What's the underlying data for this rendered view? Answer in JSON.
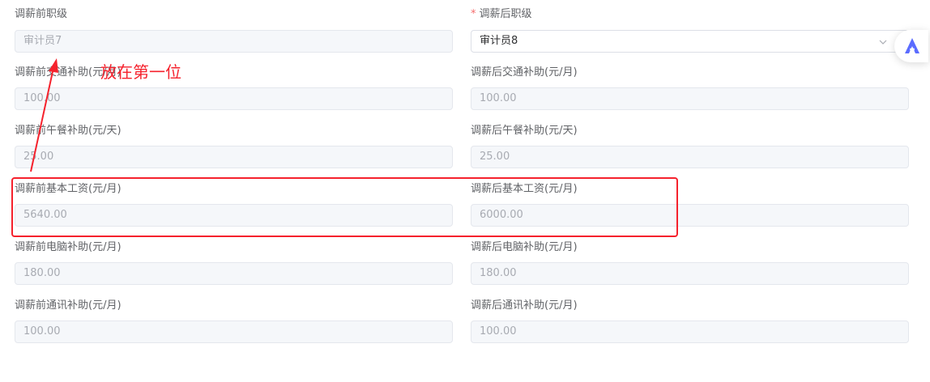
{
  "form": {
    "fields": [
      {
        "before_label": "调薪前职级",
        "before_value": "审计员7",
        "after_label": "调薪后职级",
        "after_value": "审计员8",
        "after_required": "*"
      },
      {
        "before_label": "调薪前交通补助(元/月)",
        "before_value": "100.00",
        "after_label": "调薪后交通补助(元/月)",
        "after_value": "100.00"
      },
      {
        "before_label": "调薪前午餐补助(元/天)",
        "before_value": "25.00",
        "after_label": "调薪后午餐补助(元/天)",
        "after_value": "25.00"
      },
      {
        "before_label": "调薪前基本工资(元/月)",
        "before_value": "5640.00",
        "after_label": "调薪后基本工资(元/月)",
        "after_value": "6000.00"
      },
      {
        "before_label": "调薪前电脑补助(元/月)",
        "before_value": "180.00",
        "after_label": "调薪后电脑补助(元/月)",
        "after_value": "180.00"
      },
      {
        "before_label": "调薪前通讯补助(元/月)",
        "before_value": "100.00",
        "after_label": "调薪后通讯补助(元/月)",
        "after_value": "100.00"
      }
    ]
  },
  "annotation": {
    "text": "放在第一位",
    "color": "#f5222d"
  },
  "icons": {
    "select_arrow": "chevron-down-icon",
    "clear": "circle-clear-icon",
    "assistant": "assistant-logo-icon"
  },
  "colors": {
    "required": "#f56c6c",
    "disabled_bg": "#f5f7fa",
    "annotation": "#f5222d",
    "assistant_brand": "#5b6cff"
  }
}
